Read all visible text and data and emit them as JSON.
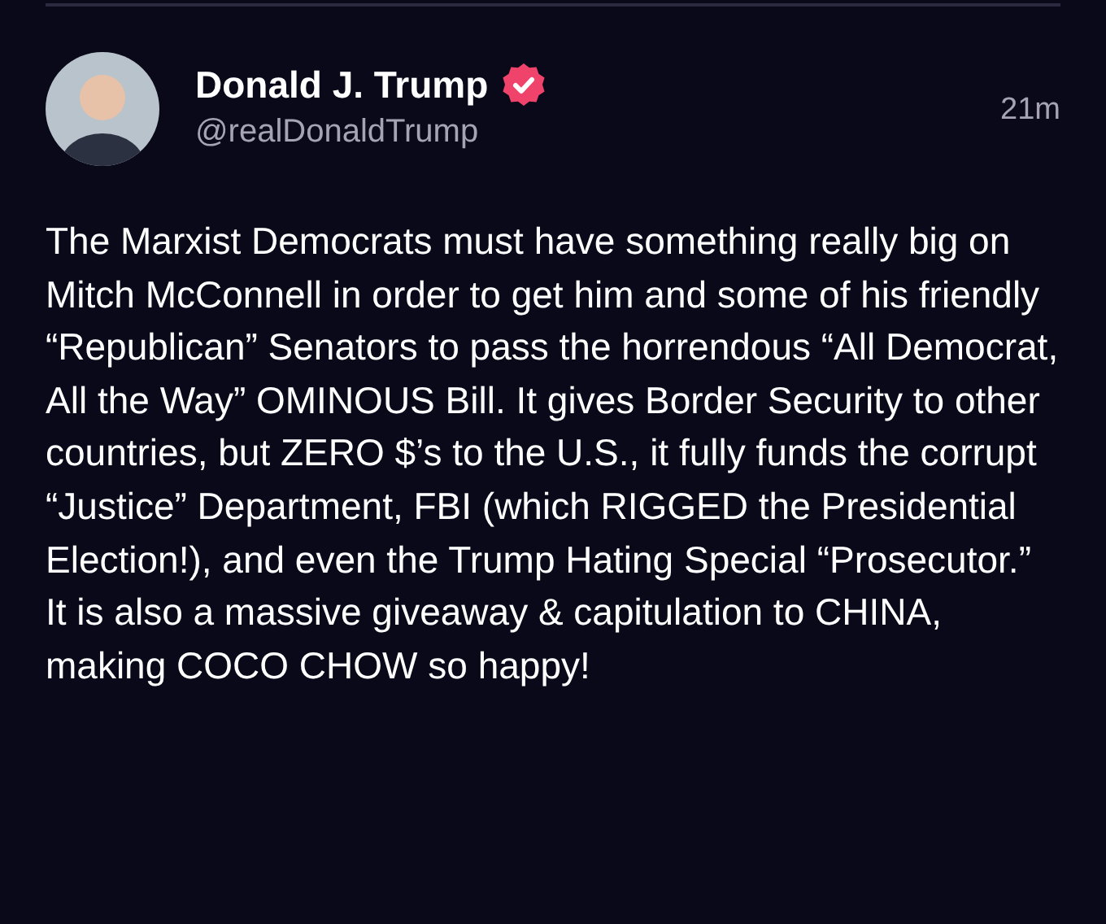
{
  "post": {
    "author": {
      "name": "Donald J. Trump",
      "handle": "@realDonaldTrump",
      "verified": true
    },
    "time": "21m",
    "text": "The Marxist Democrats must have something really big on Mitch McConnell in order to get him and some of his friendly “Republican” Senators to pass the horrendous “All Democrat, All the Way” OMINOUS Bill. It gives Border Security to other countries, but ZERO $’s to the U.S., it fully funds the corrupt “Justice” Department, FBI (which RIGGED the Presidential Election!), and even the Trump Hating Special “Prosecutor.” It is also a massive giveaway & capitulation to CHINA, making COCO CHOW so happy!"
  }
}
